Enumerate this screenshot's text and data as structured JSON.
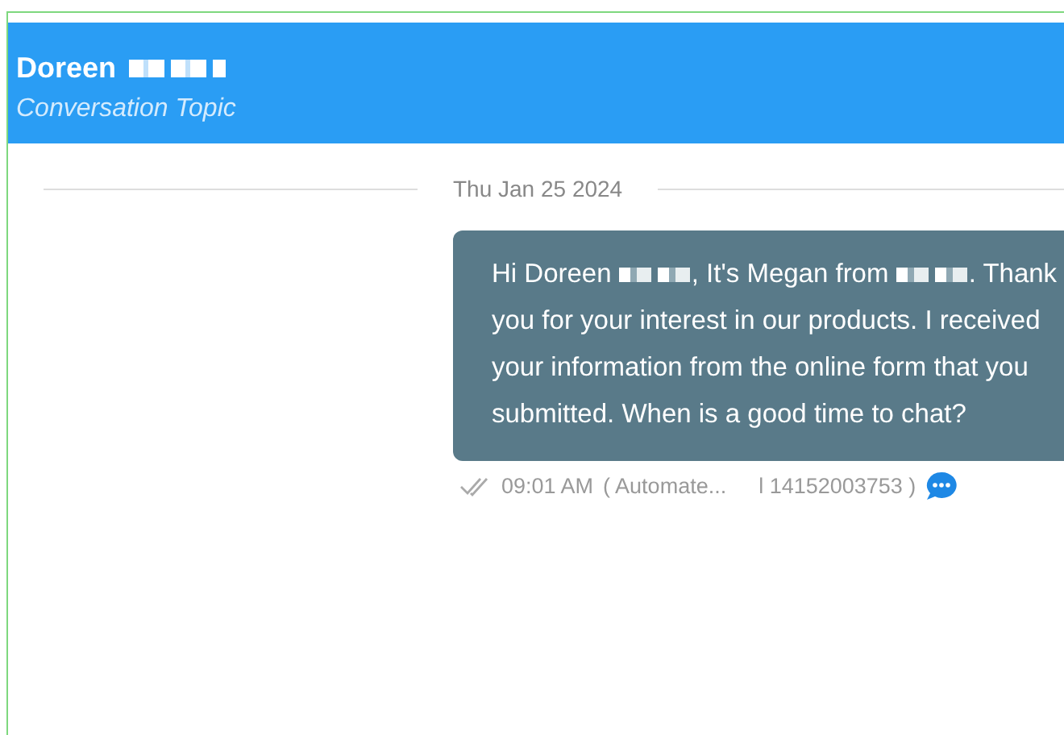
{
  "header": {
    "title": [
      {
        "kind": "text",
        "text": "Doreen"
      },
      {
        "kind": "redacted"
      }
    ],
    "subtitle": "Conversation Topic"
  },
  "date_divider": "Thu Jan 25 2024",
  "message": {
    "segments": [
      {
        "kind": "text",
        "text": "Hi Doreen "
      },
      {
        "kind": "redacted"
      },
      {
        "kind": "text",
        "text": ", It's Megan from "
      },
      {
        "kind": "redacted"
      },
      {
        "kind": "text",
        "text": ". Thank you for your interest in our products. I received your information from the online form that you submitted. When is a good time to chat?"
      }
    ],
    "read": true,
    "time": "09:01 AM",
    "source": "( Automate...",
    "number": "l 14152003753 )"
  }
}
